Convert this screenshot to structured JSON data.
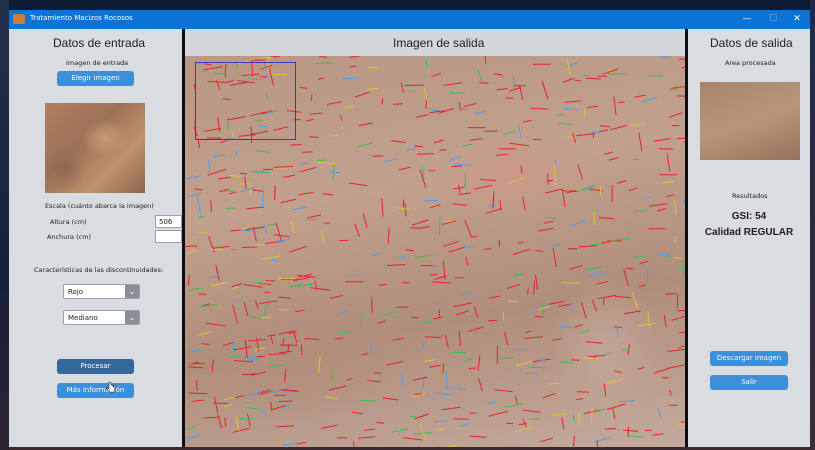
{
  "window": {
    "title": "Tratamiento Macizos Rocosos",
    "minimize_glyph": "—",
    "maximize_glyph": "☐",
    "close_glyph": "✕"
  },
  "input_panel": {
    "heading": "Datos de entrada",
    "image_label": "Imagen de entrada",
    "choose_image_button": "Elegir imagen",
    "scale_label": "Escala (cuánto abarca la imagen)",
    "height_label": "Altura (cm)",
    "height_value": "506",
    "width_label": "Anchura (cm)",
    "width_value": "",
    "discontinuities_label": "Características de las discontinuidades:",
    "color_select": "Rojo",
    "size_select": "Mediano",
    "process_button": "Procesar",
    "more_info_button": "Más información"
  },
  "output_image_panel": {
    "heading": "Imagen de salida"
  },
  "output_panel": {
    "heading": "Datos de salida",
    "area_label": "Area procesada",
    "results_label": "Resultados",
    "gsi": "GSI: 54",
    "quality": "Calidad REGULAR",
    "download_button": "Descargar imagen",
    "exit_button": "Salir"
  },
  "colors": {
    "titlebar": "#0b73d6",
    "button": "#3c8fd8",
    "button_pressed": "#35689b",
    "panel": "#d9dce1",
    "roi_box": "#3b37c4",
    "fracture_lines": "#e8232a"
  },
  "icons": [
    "app-icon",
    "minimize-icon",
    "maximize-icon",
    "close-icon",
    "chevron-down-icon",
    "mouse-cursor-icon"
  ]
}
